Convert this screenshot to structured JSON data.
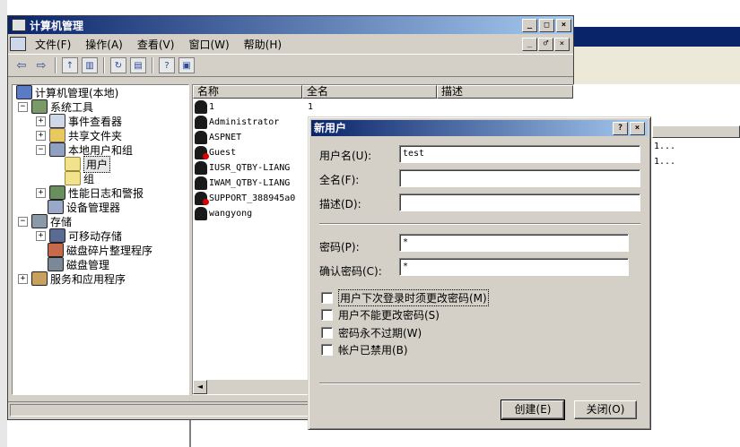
{
  "window": {
    "title": "计算机管理",
    "menu": [
      "文件(F)",
      "操作(A)",
      "查看(V)",
      "窗口(W)",
      "帮助(H)"
    ],
    "title_buttons": [
      "_",
      "□",
      "×"
    ],
    "inner_buttons": [
      "_",
      "♂",
      "×"
    ]
  },
  "tree": {
    "items": [
      {
        "label": "计算机管理(本地)",
        "icon": "computer-icon"
      },
      {
        "label": "系统工具",
        "icon": "tools-icon",
        "expander": "−"
      },
      {
        "label": "事件查看器",
        "icon": "event-viewer-icon",
        "expander": "+"
      },
      {
        "label": "共享文件夹",
        "icon": "shared-folder-icon",
        "expander": "+"
      },
      {
        "label": "本地用户和组",
        "icon": "users-groups-icon",
        "expander": "−"
      },
      {
        "label": "用户",
        "icon": "folder-open-icon"
      },
      {
        "label": "组",
        "icon": "folder-icon"
      },
      {
        "label": "性能日志和警报",
        "icon": "performance-icon",
        "expander": "+"
      },
      {
        "label": "设备管理器",
        "icon": "device-manager-icon"
      },
      {
        "label": "存储",
        "icon": "storage-icon",
        "expander": "−"
      },
      {
        "label": "可移动存储",
        "icon": "removable-storage-icon",
        "expander": "+"
      },
      {
        "label": "磁盘碎片整理程序",
        "icon": "defrag-icon"
      },
      {
        "label": "磁盘管理",
        "icon": "disk-management-icon"
      },
      {
        "label": "服务和应用程序",
        "icon": "services-icon",
        "expander": "+"
      }
    ]
  },
  "list": {
    "columns": [
      "名称",
      "全名",
      "描述"
    ],
    "rows": [
      {
        "name": "1",
        "fullname": "1"
      },
      {
        "name": "Administrator",
        "fullname": ""
      },
      {
        "name": "ASPNET",
        "fullname": ""
      },
      {
        "name": "Guest",
        "fullname": ""
      },
      {
        "name": "IUSR_QTBY-LIANG",
        "fullname": ""
      },
      {
        "name": "IWAM_QTBY-LIANG",
        "fullname": ""
      },
      {
        "name": "SUPPORT_388945a0",
        "fullname": ""
      },
      {
        "name": "wangyong",
        "fullname": ""
      }
    ],
    "scroll_left": "◄"
  },
  "right_list": {
    "rows": [
      "1...",
      "1..."
    ]
  },
  "dialog": {
    "title": "新用户",
    "title_buttons": [
      "?",
      "×"
    ],
    "username_label": "用户名(U):",
    "username_value": "test",
    "fullname_label": "全名(F):",
    "fullname_value": "",
    "description_label": "描述(D):",
    "description_value": "",
    "password_label": "密码(P):",
    "password_value": "*",
    "confirm_label": "确认密码(C):",
    "confirm_value": "*",
    "checkboxes": [
      {
        "label": "用户下次登录时须更改密码(M)",
        "checked": false
      },
      {
        "label": "用户不能更改密码(S)",
        "checked": false
      },
      {
        "label": "密码永不过期(W)",
        "checked": false
      },
      {
        "label": "帐户已禁用(B)",
        "checked": false
      }
    ],
    "create_button": "创建(E)",
    "close_button": "关闭(O)"
  },
  "colors": {
    "titlebar": "#0a246a",
    "face": "#d4d0c8"
  }
}
